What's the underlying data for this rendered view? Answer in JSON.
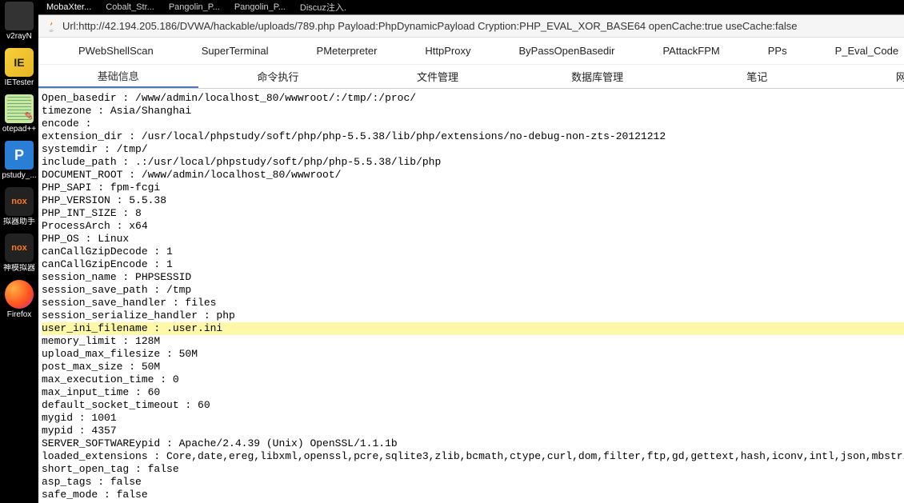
{
  "taskbar": [
    {
      "label": "v2rayN",
      "icon": ""
    },
    {
      "label": "IETester",
      "icon": "ie"
    },
    {
      "label": "otepad++",
      "icon": "np"
    },
    {
      "label": "pstudy_...",
      "icon": "pp"
    },
    {
      "label": "拟器助手",
      "icon": "nox"
    },
    {
      "label": "神模拟器",
      "icon": "nox"
    },
    {
      "label": "Firefox",
      "icon": "ff"
    }
  ],
  "topTabs": [
    "MobaXter...",
    "Cobalt_Str...",
    "Pangolin_P...",
    "Pangolin_P...",
    "Discuz注入."
  ],
  "urlBar": "Url:http://42.194.205.186/DVWA/hackable/uploads/789.php Payload:PhpDynamicPayload Cryption:PHP_EVAL_XOR_BASE64 openCache:true useCache:false",
  "pTabs": [
    "PWebShellScan",
    "SuperTerminal",
    "PMeterpreter",
    "HttpProxy",
    "ByPassOpenBasedir",
    "PAttackFPM",
    "PPs",
    "P_Eval_Code"
  ],
  "subTabs": [
    "基础信息",
    "命令执行",
    "文件管理",
    "数据库管理",
    "笔记",
    "网络详情"
  ],
  "activeSubTab": 0,
  "lines": [
    {
      "t": "Open_basedir : /www/admin/localhost_80/wwwroot/:/tmp/:/proc/"
    },
    {
      "t": "timezone : Asia/Shanghai"
    },
    {
      "t": "encode : "
    },
    {
      "t": "extension_dir : /usr/local/phpstudy/soft/php/php-5.5.38/lib/php/extensions/no-debug-non-zts-20121212"
    },
    {
      "t": "systemdir : /tmp/"
    },
    {
      "t": "include_path : .:/usr/local/phpstudy/soft/php/php-5.5.38/lib/php"
    },
    {
      "t": "DOCUMENT_ROOT : /www/admin/localhost_80/wwwroot/"
    },
    {
      "t": "PHP_SAPI : fpm-fcgi"
    },
    {
      "t": "PHP_VERSION : 5.5.38"
    },
    {
      "t": "PHP_INT_SIZE : 8"
    },
    {
      "t": "ProcessArch : x64"
    },
    {
      "t": "PHP_OS : Linux"
    },
    {
      "t": "canCallGzipDecode : 1"
    },
    {
      "t": "canCallGzipEncode : 1"
    },
    {
      "t": "session_name : PHPSESSID"
    },
    {
      "t": "session_save_path : /tmp"
    },
    {
      "t": "session_save_handler : files"
    },
    {
      "t": "session_serialize_handler : php"
    },
    {
      "t": "user_ini_filename : .user.ini",
      "hl": true
    },
    {
      "t": "memory_limit : 128M"
    },
    {
      "t": "upload_max_filesize : 50M"
    },
    {
      "t": "post_max_size : 50M"
    },
    {
      "t": "max_execution_time : 0"
    },
    {
      "t": "max_input_time : 60"
    },
    {
      "t": "default_socket_timeout : 60"
    },
    {
      "t": "mygid : 1001"
    },
    {
      "t": "mypid : 4357"
    },
    {
      "t": "SERVER_SOFTWAREypid : Apache/2.4.39 (Unix) OpenSSL/1.1.1b"
    },
    {
      "t": "loaded_extensions : Core,date,ereg,libxml,openssl,pcre,sqlite3,zlib,bcmath,ctype,curl,dom,filter,ftp,gd,gettext,hash,iconv,intl,json,mbstring,mcrypt,SPL,"
    },
    {
      "t": "short_open_tag : false"
    },
    {
      "t": "asp_tags : false"
    },
    {
      "t": "safe_mode : false"
    }
  ]
}
